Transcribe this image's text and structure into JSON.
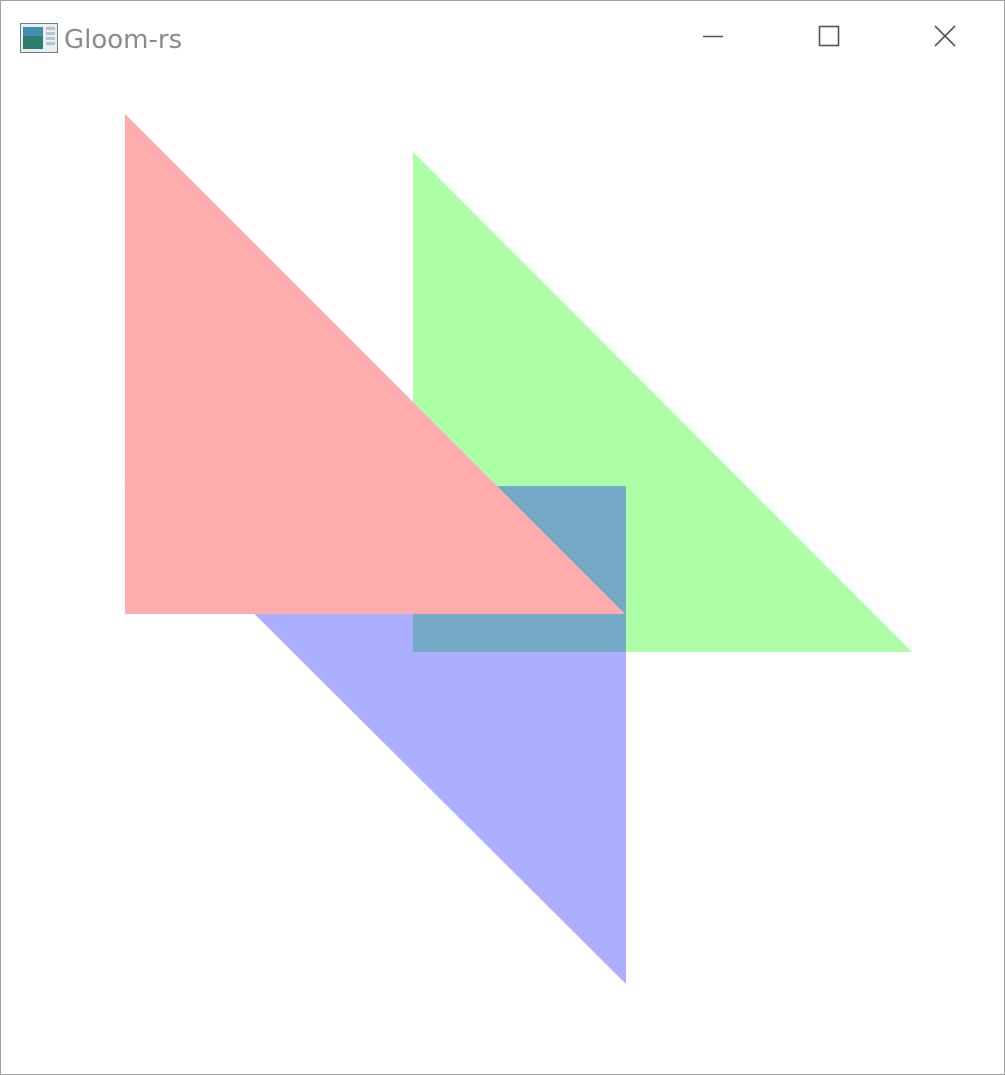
{
  "window": {
    "title": "Gloom-rs",
    "app_icon": "app-window-icon",
    "controls": {
      "minimize_icon": "minimize-icon",
      "maximize_icon": "maximize-icon",
      "close_icon": "close-icon"
    }
  },
  "scene": {
    "background_color": "#ffffff",
    "overlap_color": "#74aac6",
    "triangles": [
      {
        "name": "blue-triangle",
        "color": "#acaeff"
      },
      {
        "name": "green-triangle",
        "color": "#acffa6"
      },
      {
        "name": "red-triangle",
        "color": "#ffacac"
      }
    ]
  }
}
